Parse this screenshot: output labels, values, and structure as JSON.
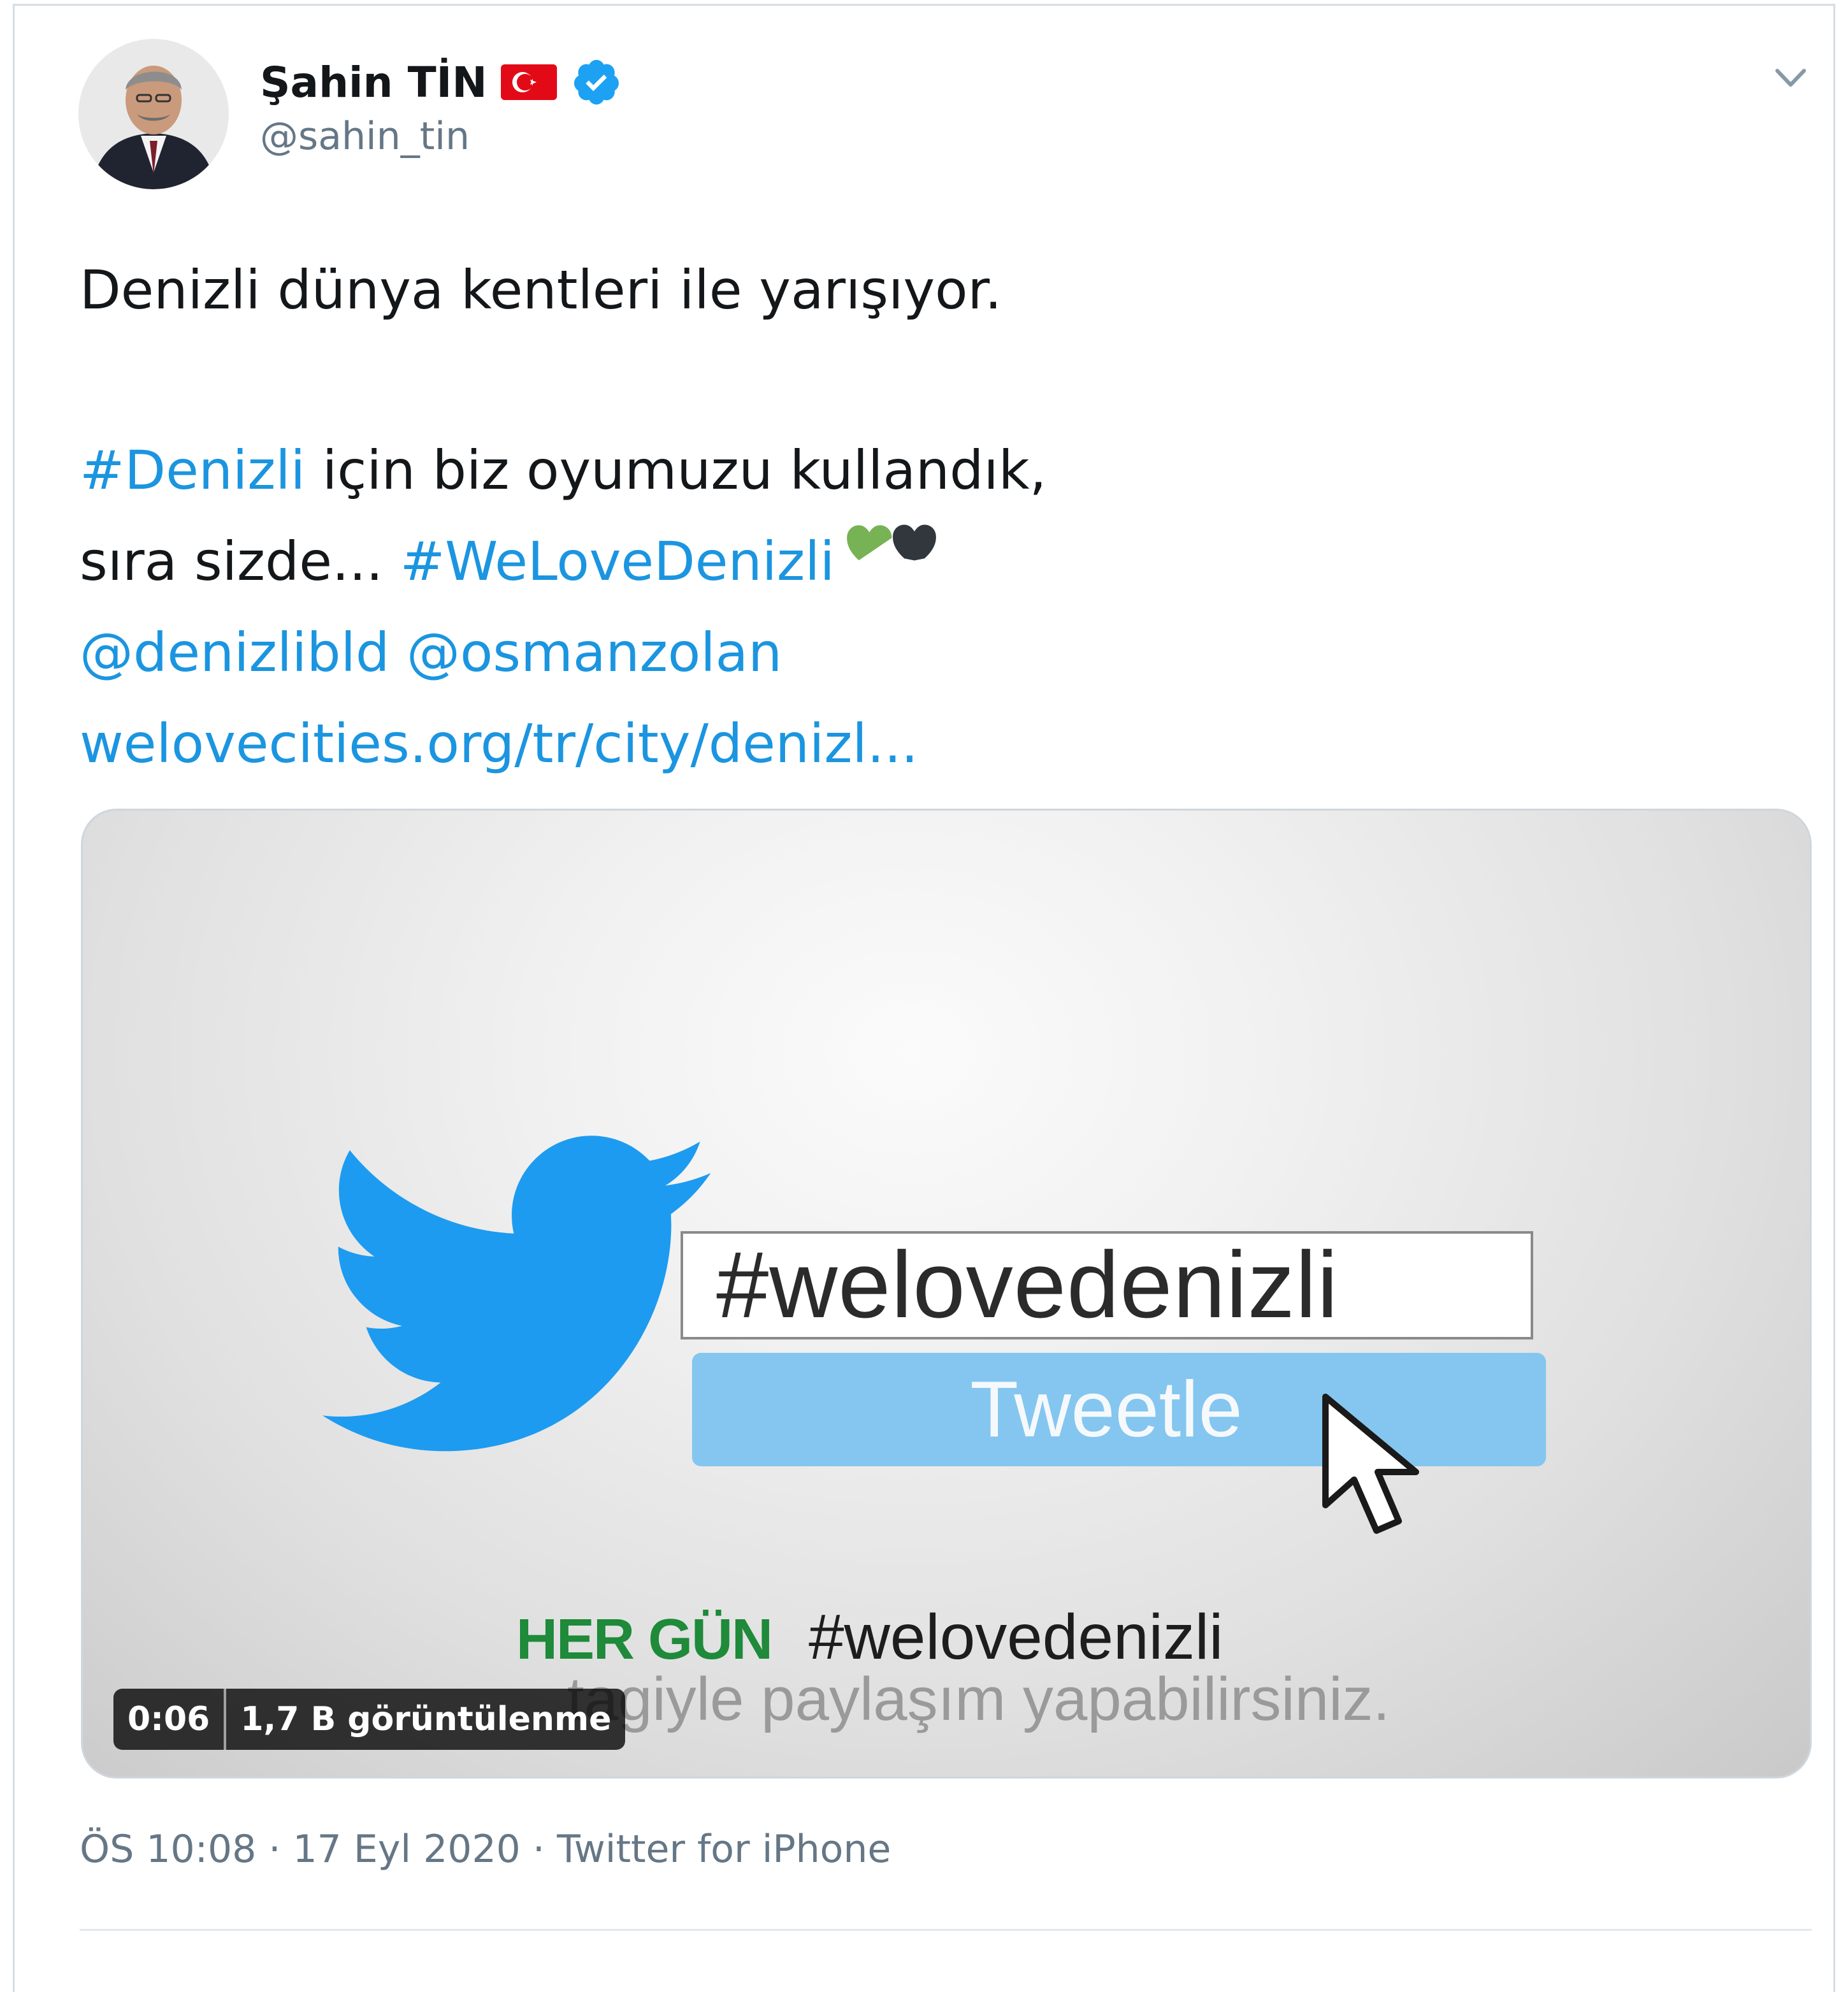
{
  "author": {
    "display_name": "Şahin TİN",
    "handle": "@sahin_tin",
    "flag_icon": "turkey-flag-icon",
    "verified_icon": "verified-badge-icon",
    "verified_color": "#1da1f2"
  },
  "tweet": {
    "line1": "Denizli dünya kentleri ile yarışıyor.",
    "hashtag_denizli": "#Denizli",
    "line3_rest": " için biz oyumuzu kullandık,",
    "line4_prefix": "sıra sizde... ",
    "hashtag_welovedenizli": "#WeLoveDenizli",
    "mention1": "@denizlibld",
    "mention2": "@osmanzolan",
    "url": "welovecities.org/tr/city/denizl...",
    "emoji1": "green-heart",
    "emoji2": "black-heart",
    "link_color": "#1b95e0"
  },
  "media": {
    "input_text": "#welovedenizli",
    "button_label": "Tweetle",
    "caption_prefix": "HER GÜN",
    "caption_hashtag": "#welovedenizli",
    "subcaption": "tagiyle paylaşım yapabilirsiniz.",
    "duration": "0:06",
    "views": "1,7 B görüntülenme"
  },
  "meta": {
    "timestamp": "ÖS 10:08 · 17 Eyl 2020 · Twitter for iPhone"
  }
}
